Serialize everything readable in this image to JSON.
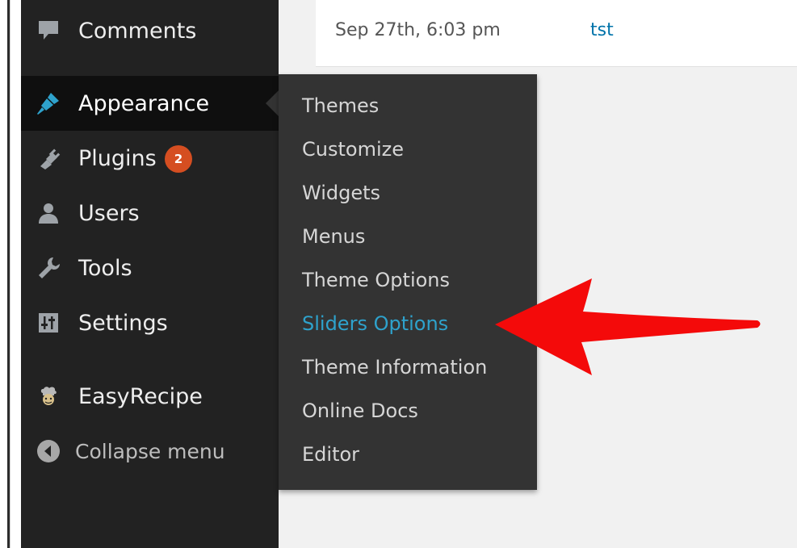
{
  "sidebar": {
    "items": [
      {
        "key": "comments",
        "label": "Comments",
        "icon": "comment-icon"
      },
      {
        "key": "appearance",
        "label": "Appearance",
        "icon": "paintbrush-icon",
        "current": true
      },
      {
        "key": "plugins",
        "label": "Plugins",
        "icon": "plugin-icon",
        "badge": "2"
      },
      {
        "key": "users",
        "label": "Users",
        "icon": "user-icon"
      },
      {
        "key": "tools",
        "label": "Tools",
        "icon": "wrench-icon"
      },
      {
        "key": "settings",
        "label": "Settings",
        "icon": "sliders-icon"
      },
      {
        "key": "easyrecipe",
        "label": "EasyRecipe",
        "icon": "chef-icon"
      },
      {
        "key": "collapse",
        "label": "Collapse menu",
        "icon": "collapse-arrow-icon"
      }
    ]
  },
  "submenu": {
    "items": [
      {
        "label": "Themes"
      },
      {
        "label": "Customize"
      },
      {
        "label": "Widgets"
      },
      {
        "label": "Menus"
      },
      {
        "label": "Theme Options"
      },
      {
        "label": "Sliders Options",
        "active": true
      },
      {
        "label": "Theme Information"
      },
      {
        "label": "Online Docs"
      },
      {
        "label": "Editor"
      }
    ]
  },
  "top_row": {
    "date": "Sep 27th, 6:03 pm",
    "link": "tst"
  },
  "colors": {
    "sidebar_bg": "#222222",
    "submenu_bg": "#333333",
    "accent": "#2ea2cc",
    "badge": "#d54e21",
    "arrow": "#ff0000"
  }
}
